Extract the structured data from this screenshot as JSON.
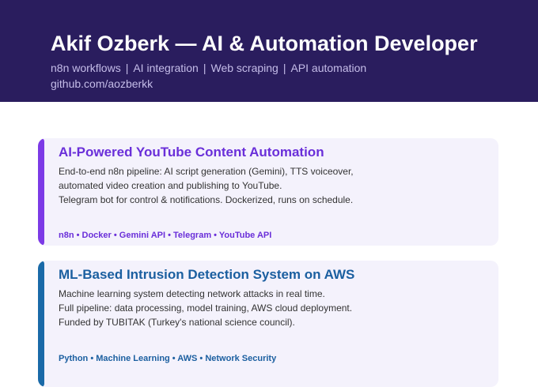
{
  "header": {
    "title": "Akif Ozberk — AI & Automation Developer",
    "tags": [
      "n8n workflows",
      "AI integration",
      "Web scraping",
      "API automation"
    ],
    "separator": "|",
    "link": "github.com/aozberkk",
    "background_color": "#2a1d5e"
  },
  "projects": [
    {
      "title": "AI-Powered YouTube Content Automation",
      "description": [
        "End-to-end n8n pipeline: AI script generation (Gemini), TTS voiceover,",
        "automated video creation and publishing to YouTube.",
        "Telegram bot for control & notifications. Dockerized, runs on schedule."
      ],
      "tech": "n8n • Docker • Gemini API • Telegram • YouTube API",
      "accent_color": "#7c3ae6"
    },
    {
      "title": "ML-Based Intrusion Detection System on AWS",
      "description": [
        "Machine learning system detecting network attacks in real time.",
        "Full pipeline: data processing, model training, AWS cloud deployment.",
        "Funded by TUBITAK (Turkey's national science council)."
      ],
      "tech": "Python • Machine Learning • AWS • Network Security",
      "accent_color": "#1a6aa8"
    }
  ]
}
